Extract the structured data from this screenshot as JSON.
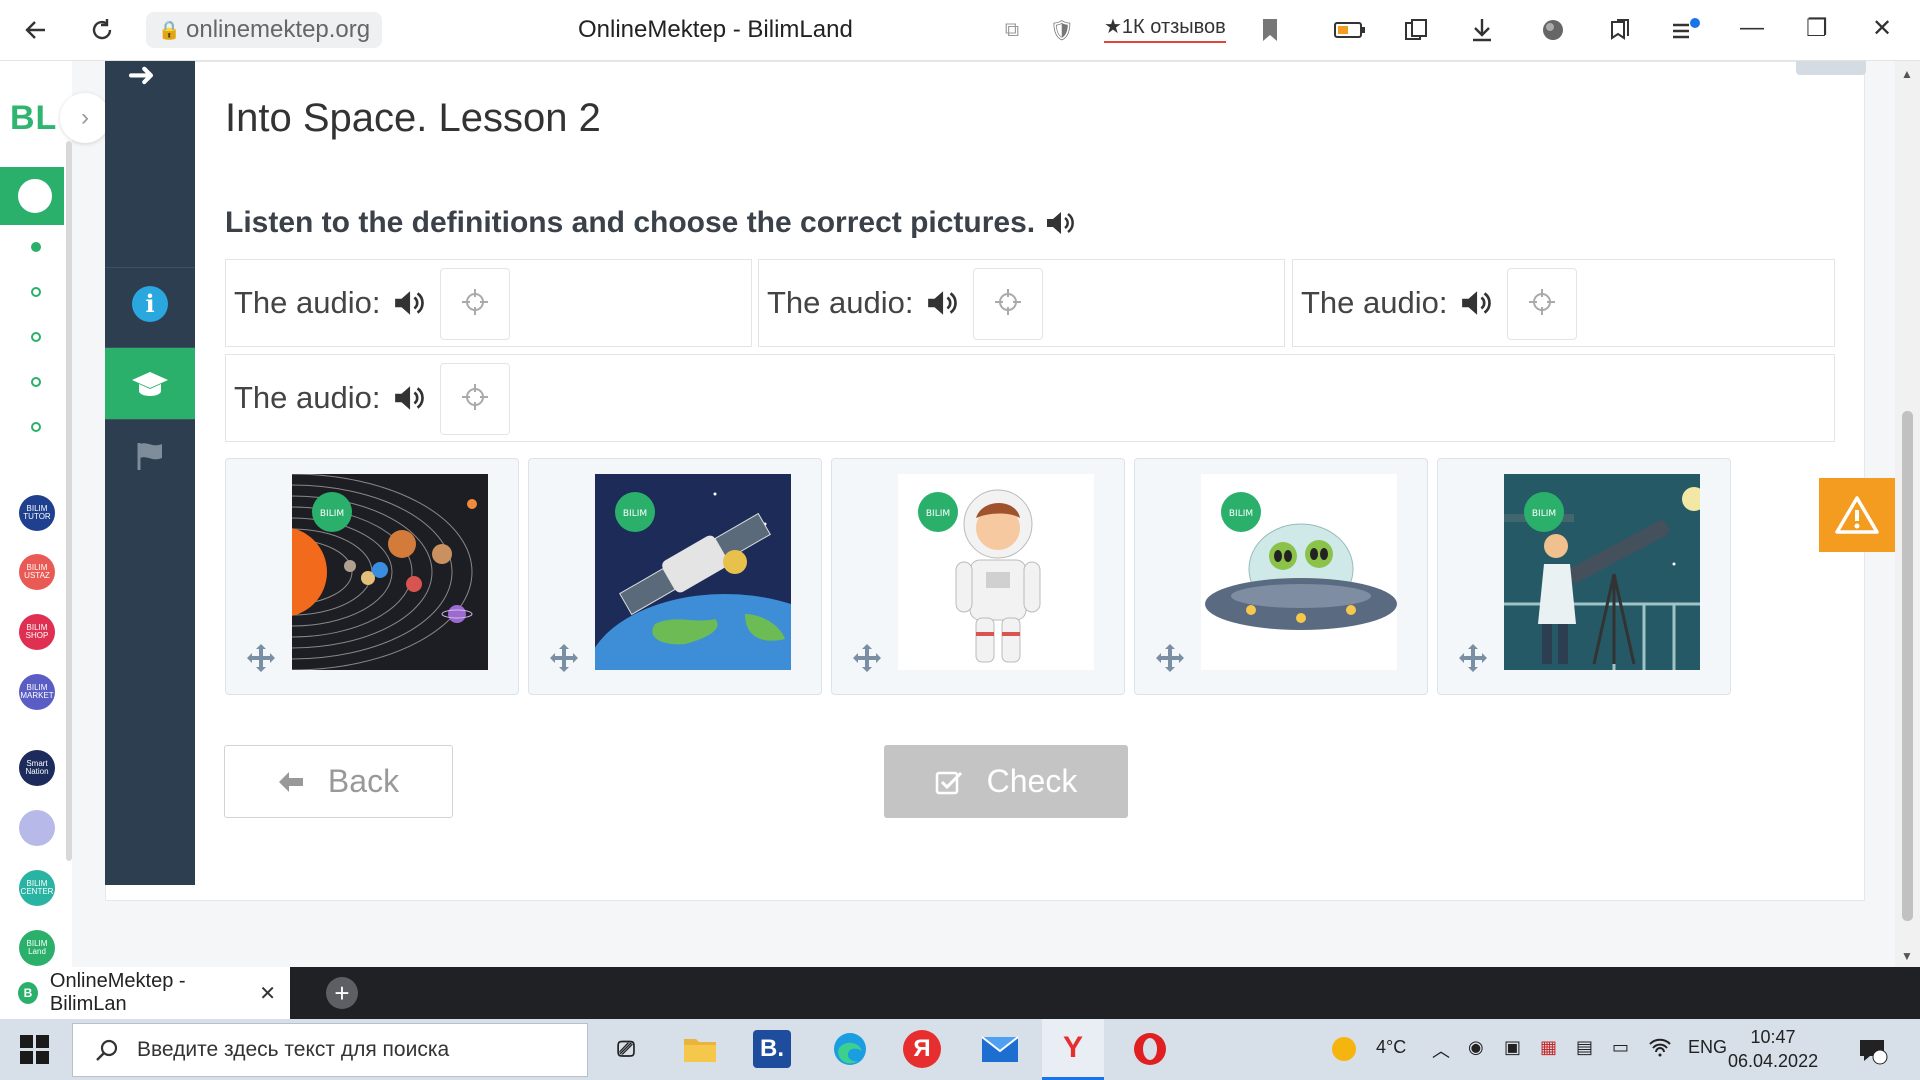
{
  "browser": {
    "url": "onlinemektep.org",
    "title": "OnlineMektep - BilimLand",
    "reviews": "★1К отзывов",
    "tab_label": "OnlineMektep - BilimLan",
    "tab_close": "✕",
    "new_tab": "+"
  },
  "site": {
    "logo": "BL",
    "logo_arrow": "›",
    "apps": [
      {
        "label": "BILIM TUTOR",
        "color": "#1f3f8f"
      },
      {
        "label": "BILIM USTAZ",
        "color": "#ea5a55"
      },
      {
        "label": "BILIM SHOP",
        "color": "#e03052"
      },
      {
        "label": "BILIM MARKET",
        "color": "#5a5ec4"
      },
      {
        "label": "Smart Nation",
        "color": "#1c2a5c"
      },
      {
        "label": "",
        "color": "#b7b9e8"
      },
      {
        "label": "BILIM CENTER",
        "color": "#29b3a2"
      },
      {
        "label": "BILIM Land",
        "color": "#2ab06b"
      }
    ]
  },
  "lesson": {
    "title": "Into Space. Lesson 2",
    "instruction": "Listen to the definitions and choose the correct pictures.",
    "slots": [
      {
        "label": "The audio:"
      },
      {
        "label": "The audio:"
      },
      {
        "label": "The audio:"
      },
      {
        "label": "The audio:"
      }
    ],
    "pictures": [
      {
        "name": "solar-system"
      },
      {
        "name": "satellite"
      },
      {
        "name": "astronaut"
      },
      {
        "name": "ufo-aliens"
      },
      {
        "name": "astronomer-telescope"
      }
    ],
    "back_label": "Back",
    "check_label": "Check"
  },
  "taskbar": {
    "search_placeholder": "Введите здесь текст для поиска",
    "temperature": "4°C",
    "language": "ENG",
    "time": "10:47",
    "date": "06.04.2022",
    "apps": [
      "task-view",
      "file-explorer",
      "vk",
      "edge",
      "yandex",
      "mail",
      "yandex-browser",
      "opera"
    ]
  },
  "colors": {
    "accent_green": "#2ab06b",
    "dark_panel": "#2c3e50",
    "info_blue": "#2aa7df",
    "warning_orange": "#f39c1f"
  }
}
